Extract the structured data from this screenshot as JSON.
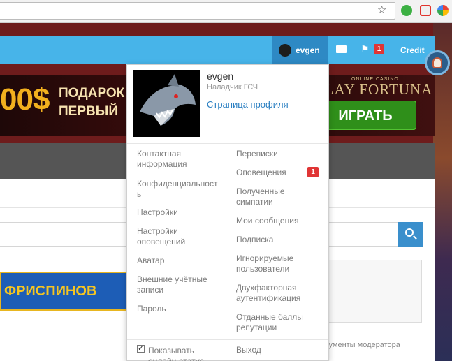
{
  "browser": {
    "toolbar_icons": [
      "star-icon",
      "extension-green-icon",
      "extension-red-icon",
      "chrome-extension-icon"
    ]
  },
  "navbar": {
    "username": "evgen",
    "alerts_badge": "1",
    "credit_label": "Credit"
  },
  "banner": {
    "amount_text": "00$",
    "gift_line1": "ПОДАРОК",
    "gift_line2": "ПЕРВЫЙ",
    "logo_small": "ONLINE CASINO",
    "logo": "PLAY FORTUNA",
    "play_button": "ИГРАТЬ"
  },
  "freespins_banner": {
    "text": "ФРИСПИНОВ"
  },
  "moderator_tools_label": "Инструменты модератора",
  "dropdown": {
    "username": "evgen",
    "role": "Наладчик ГСЧ",
    "profile_link": "Страница профиля",
    "left_items": [
      "Контактная информация",
      "Конфиденциальность",
      "Настройки",
      "Настройки оповещений",
      "Аватар",
      "Внешние учётные записи",
      "Пароль"
    ],
    "right_items": [
      "Переписки",
      "Оповещения",
      "Полученные симпатии",
      "Мои сообщения",
      "Подписка",
      "Игнорируемые пользователи",
      "Двухфакторная аутентификация",
      "Отданные баллы репутации"
    ],
    "alerts_badge": "1",
    "show_online_label": "Показывать онлайн-статус",
    "show_online_checked": true,
    "logout_label": "Выход"
  }
}
